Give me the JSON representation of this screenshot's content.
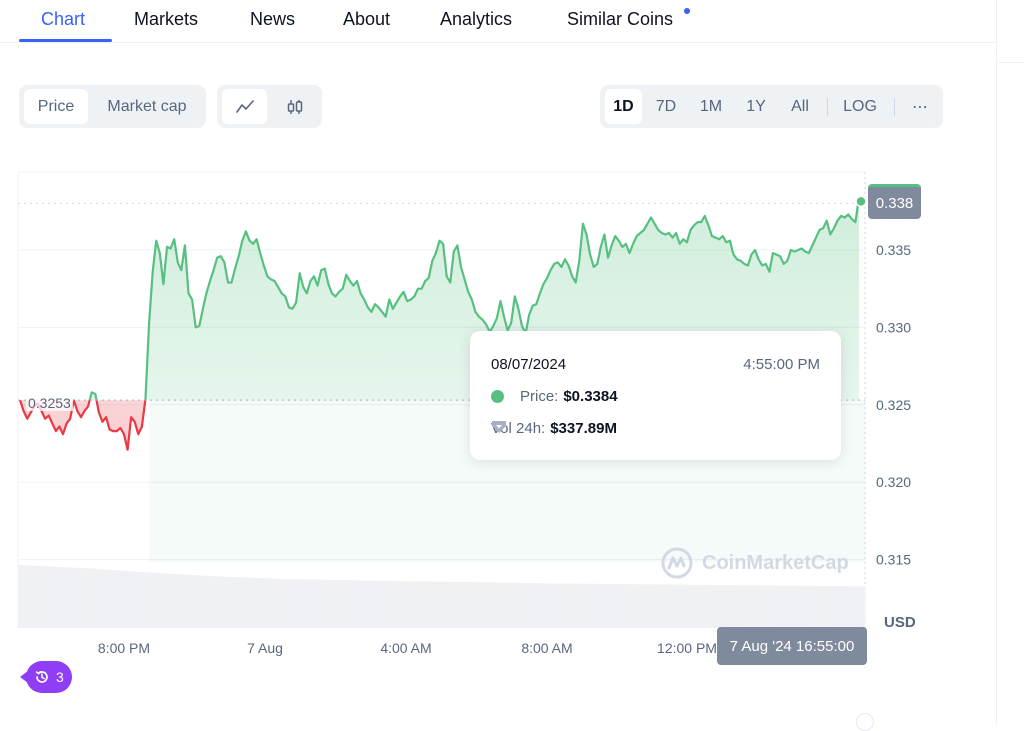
{
  "tabs": [
    {
      "label": "Chart",
      "active": true
    },
    {
      "label": "Markets"
    },
    {
      "label": "News"
    },
    {
      "label": "About"
    },
    {
      "label": "Analytics"
    },
    {
      "label": "Similar Coins",
      "has_dot": true
    }
  ],
  "controls": {
    "metric_toggle": [
      {
        "label": "Price",
        "selected": true
      },
      {
        "label": "Market cap"
      }
    ],
    "chart_type_toggle": [
      {
        "icon": "line-chart-icon",
        "selected": true
      },
      {
        "icon": "candlestick-icon"
      }
    ],
    "ranges": [
      {
        "label": "1D",
        "selected": true
      },
      {
        "label": "7D"
      },
      {
        "label": "1M"
      },
      {
        "label": "1Y"
      },
      {
        "label": "All"
      }
    ],
    "log_label": "LOG",
    "more_label": "⋯"
  },
  "colors": {
    "accent": "#3861fb",
    "up": "#57c081",
    "down": "#ea3943",
    "tag_bg": "#808a9d",
    "badge": "#8f3ef5"
  },
  "tooltip": {
    "date": "08/07/2024",
    "time": "4:55:00 PM",
    "price_label": "Price:",
    "price_value": "$0.3384",
    "vol_label": "Vol 24h:",
    "vol_value": "$337.89M"
  },
  "current_price_tag": "0.338",
  "open_price_label": "0.3253",
  "crosshair_time": "7 Aug '24 16:55:00",
  "currency": "USD",
  "history_badge_count": "3",
  "watermark": "CoinMarketCap",
  "chart_data": {
    "type": "area",
    "title": "",
    "xlabel": "",
    "ylabel": "USD",
    "baseline": 0.3253,
    "ylim": [
      0.3115,
      0.3405
    ],
    "yticks": [
      0.315,
      0.32,
      0.325,
      0.33,
      0.335
    ],
    "ytick_labels": [
      "0.315",
      "0.320",
      "0.325",
      "0.330",
      "0.335"
    ],
    "xtick_labels": [
      "8:00 PM",
      "7 Aug",
      "4:00 AM",
      "8:00 AM",
      "12:00 PM"
    ],
    "xtick_positions": [
      0.125,
      0.292,
      0.458,
      0.625,
      0.792
    ],
    "grid": true,
    "series": [
      {
        "name": "Price",
        "values": [
          0.3253,
          0.3246,
          0.3241,
          0.3245,
          0.3249,
          0.3251,
          0.3246,
          0.3241,
          0.3243,
          0.3238,
          0.3233,
          0.3236,
          0.3231,
          0.3238,
          0.3241,
          0.3253,
          0.3246,
          0.3242,
          0.3246,
          0.3249,
          0.3258,
          0.3257,
          0.3245,
          0.3239,
          0.3242,
          0.3234,
          0.3233,
          0.3233,
          0.3235,
          0.3231,
          0.3221,
          0.3242,
          0.3239,
          0.3231,
          0.3236,
          0.3254,
          0.3303,
          0.3336,
          0.3356,
          0.3348,
          0.3328,
          0.3352,
          0.3351,
          0.3357,
          0.3342,
          0.3337,
          0.3353,
          0.3322,
          0.3318,
          0.33,
          0.3301,
          0.3312,
          0.3322,
          0.333,
          0.3337,
          0.3345,
          0.3346,
          0.3342,
          0.3329,
          0.3329,
          0.3338,
          0.3346,
          0.3356,
          0.3362,
          0.3356,
          0.3354,
          0.3357,
          0.3348,
          0.334,
          0.3333,
          0.3331,
          0.333,
          0.3326,
          0.3322,
          0.332,
          0.3313,
          0.3312,
          0.3316,
          0.3335,
          0.3326,
          0.3322,
          0.333,
          0.3333,
          0.3327,
          0.3337,
          0.3338,
          0.3328,
          0.3322,
          0.332,
          0.3323,
          0.3325,
          0.3334,
          0.333,
          0.3327,
          0.333,
          0.3322,
          0.3318,
          0.3313,
          0.331,
          0.3315,
          0.3313,
          0.331,
          0.3307,
          0.3318,
          0.3312,
          0.3316,
          0.332,
          0.3323,
          0.3317,
          0.3318,
          0.332,
          0.3325,
          0.3325,
          0.333,
          0.3332,
          0.3343,
          0.3348,
          0.3356,
          0.3354,
          0.3333,
          0.3329,
          0.3349,
          0.3353,
          0.3339,
          0.3331,
          0.3323,
          0.3318,
          0.331,
          0.3307,
          0.3305,
          0.3302,
          0.3297,
          0.3301,
          0.3306,
          0.3317,
          0.3307,
          0.3298,
          0.3303,
          0.332,
          0.3312,
          0.3301,
          0.3296,
          0.3308,
          0.3314,
          0.3315,
          0.3322,
          0.3328,
          0.3332,
          0.3337,
          0.3341,
          0.3342,
          0.3339,
          0.3344,
          0.334,
          0.3333,
          0.3329,
          0.3343,
          0.3367,
          0.336,
          0.3347,
          0.3339,
          0.3341,
          0.3352,
          0.336,
          0.3345,
          0.3353,
          0.3359,
          0.3356,
          0.3352,
          0.3354,
          0.3348,
          0.3354,
          0.3359,
          0.3361,
          0.3363,
          0.3367,
          0.3371,
          0.3367,
          0.3363,
          0.3361,
          0.336,
          0.3361,
          0.3358,
          0.3361,
          0.3354,
          0.3357,
          0.3355,
          0.3363,
          0.3366,
          0.3368,
          0.3368,
          0.3372,
          0.3366,
          0.3359,
          0.3358,
          0.3357,
          0.3359,
          0.3355,
          0.3356,
          0.3347,
          0.3344,
          0.3343,
          0.3341,
          0.334,
          0.3347,
          0.335,
          0.3344,
          0.334,
          0.3341,
          0.3336,
          0.3348,
          0.3347,
          0.3346,
          0.3341,
          0.3343,
          0.335,
          0.3349,
          0.335,
          0.3351,
          0.3349,
          0.3348,
          0.3353,
          0.3358,
          0.3363,
          0.3364,
          0.3369,
          0.336,
          0.3364,
          0.3369,
          0.3372,
          0.3371,
          0.3373,
          0.337,
          0.3368,
          0.3384
        ]
      },
      {
        "name": "Volume 24h",
        "note": "grey volume histogram, gradually declining across the day",
        "values_relative": [
          1.0,
          0.95,
          0.88,
          0.82,
          0.78,
          0.76,
          0.74,
          0.73,
          0.71,
          0.7,
          0.69,
          0.68,
          0.67,
          0.66
        ]
      }
    ]
  }
}
